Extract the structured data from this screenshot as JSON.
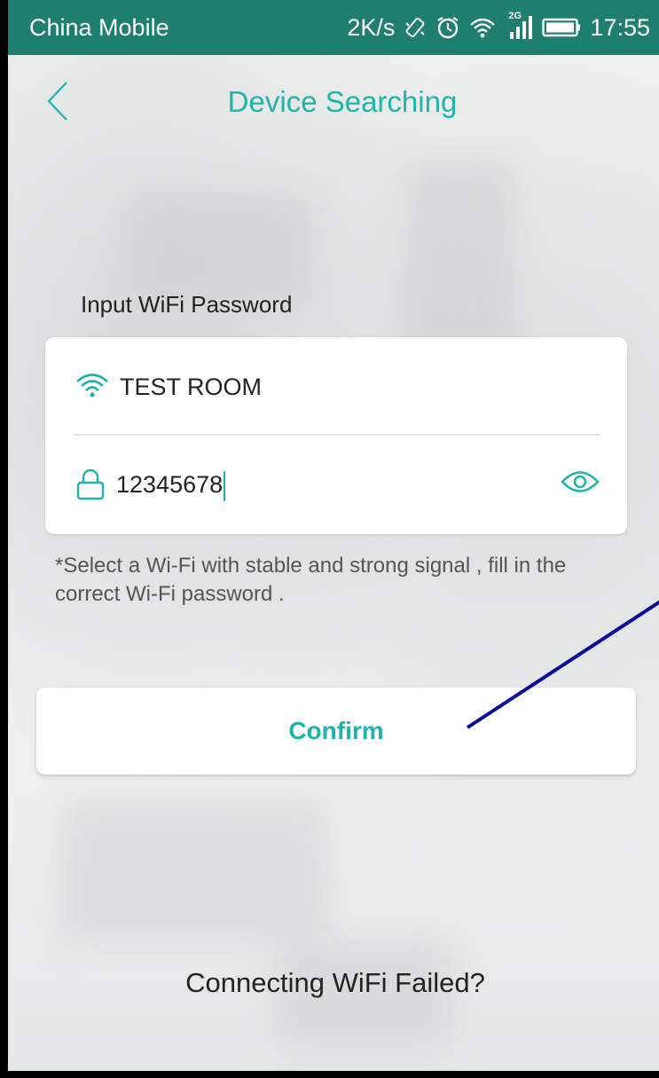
{
  "statusbar": {
    "carrier": "China Mobile",
    "speed": "2K/s",
    "network_badge": "2G",
    "time": "17:55",
    "icons": [
      "vibrate-icon",
      "alarm-icon",
      "wifi-icon",
      "signal-icon",
      "battery-icon"
    ],
    "bg_color": "#1e7f6e"
  },
  "nav": {
    "title": "Device Searching",
    "back_icon": "chevron-left-icon"
  },
  "form": {
    "label": "Input WiFi Password",
    "ssid": "TEST ROOM",
    "password": "12345678",
    "ssid_icon": "wifi-icon",
    "password_icon": "lock-icon",
    "toggle_icon": "eye-icon"
  },
  "hint": "*Select a Wi-Fi with stable and strong signal , fill in the correct Wi-Fi password .",
  "confirm_label": "Confirm",
  "footer_link": "Connecting WiFi Failed?",
  "colors": {
    "accent": "#1fb4a7",
    "annotation": "#0b0b9e"
  }
}
